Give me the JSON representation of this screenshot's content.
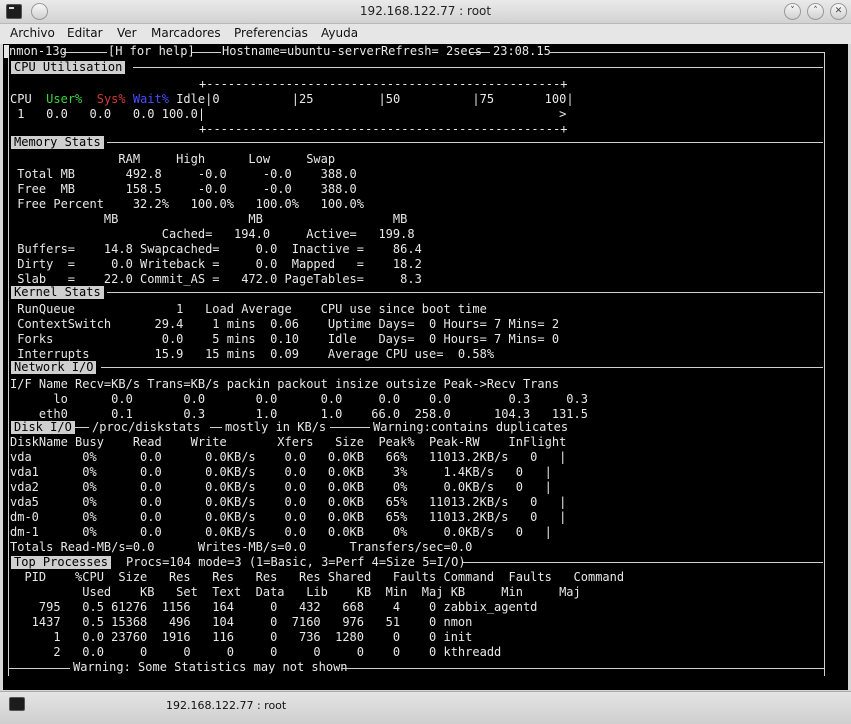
{
  "window": {
    "title": "192.168.122.77 : root",
    "buttons": [
      "˅",
      "˄",
      "✕"
    ]
  },
  "menu": [
    "Archivo",
    "Editar",
    "Ver",
    "Marcadores",
    "Preferencias",
    "Ayuda"
  ],
  "terminal": {
    "header": "nmon-13g",
    "header_help": "[H for help]",
    "header_host": "Hostname=ubuntu-serverRefresh= 2secs",
    "header_time": "23:08.15",
    "cpu": {
      "section": "CPU Utilisation",
      "scale": "+-------------------------------------------------+",
      "hdr_cpu": "CPU",
      "hdr_user": "User%",
      "hdr_sys": "Sys%",
      "hdr_wait": "Wait%",
      "hdr_rest": " Idle|0          |25         |50          |75       100|",
      "row": " 1   0.0   0.0   0.0 100.0|                                                 >",
      "scale_bottom": "+-------------------------------------------------+"
    },
    "memory": {
      "section": "Memory Stats",
      "lines": [
        "               RAM     High      Low     Swap",
        " Total MB       492.8     -0.0     -0.0    388.0",
        " Free  MB       158.5     -0.0     -0.0    388.0",
        " Free Percent    32.2%   100.0%   100.0%   100.0%",
        "             MB                  MB                  MB",
        "                     Cached=   194.0     Active=   199.8",
        " Buffers=    14.8 Swapcached=     0.0  Inactive =    86.4",
        " Dirty  =     0.0 Writeback =     0.0  Mapped   =    18.2",
        " Slab   =    22.0 Commit_AS =   472.0 PageTables=     8.3"
      ]
    },
    "kernel": {
      "section": "Kernel Stats",
      "lines": [
        " RunQueue              1   Load Average    CPU use since boot time",
        " ContextSwitch      29.4    1 mins  0.06    Uptime Days=  0 Hours= 7 Mins= 2",
        " Forks               0.0    5 mins  0.10    Idle   Days=  0 Hours= 7 Mins= 0",
        " Interrupts         15.9   15 mins  0.09    Average CPU use=  0.58%"
      ]
    },
    "network": {
      "section": "Network I/O",
      "lines": [
        "I/F Name Recv=KB/s Trans=KB/s packin packout insize outsize Peak->Recv Trans",
        "      lo      0.0       0.0       0.0      0.0     0.0    0.0        0.3     0.3",
        "    eth0      0.1       0.3       1.0      1.0    66.0  258.0      104.3   131.5"
      ]
    },
    "disk": {
      "section": "Disk I/O",
      "header_note": "/proc/diskstats",
      "header_note2": "mostly in KB/s",
      "header_note3": "Warning:contains duplicates",
      "lines": [
        "DiskName Busy    Read    Write       Xfers   Size  Peak%  Peak-RW    InFlight",
        "vda       0%      0.0      0.0KB/s    0.0   0.0KB   66%   11013.2KB/s   0   |",
        "vda1      0%      0.0      0.0KB/s    0.0   0.0KB    3%     1.4KB/s   0   |",
        "vda2      0%      0.0      0.0KB/s    0.0   0.0KB    0%     0.0KB/s   0   |",
        "vda5      0%      0.0      0.0KB/s    0.0   0.0KB   65%   11013.2KB/s   0   |",
        "dm-0      0%      0.0      0.0KB/s    0.0   0.0KB   65%   11013.2KB/s   0   |",
        "dm-1      0%      0.0      0.0KB/s    0.0   0.0KB    0%     0.0KB/s   0   |",
        "Totals Read-MB/s=0.0      Writes-MB/s=0.0      Transfers/sec=0.0"
      ]
    },
    "processes": {
      "section": "Top Processes",
      "header_note": "Procs=104 mode=3 (1=Basic, 3=Perf 4=Size 5=I/O)",
      "lines": [
        "  PID    %CPU  Size   Res   Res   Res   Res Shared   Faults Command  Faults   Command",
        "          Used    KB   Set  Text  Data   Lib    KB  Min  Maj KB     Min     Maj",
        "    795   0.5 61276  1156   164     0   432   668    4    0 zabbix_agentd",
        "   1437   0.5 15368   496   104     0  7160   976   51    0 nmon",
        "      1   0.0 23760  1916   116     0   736  1280    0    0 init",
        "      2   0.0     0     0     0     0     0     0    0    0 kthreadd"
      ],
      "footer": "Warning: Some Statistics may not shown"
    }
  },
  "taskbar": {
    "task_label": "192.168.122.77 : root"
  }
}
